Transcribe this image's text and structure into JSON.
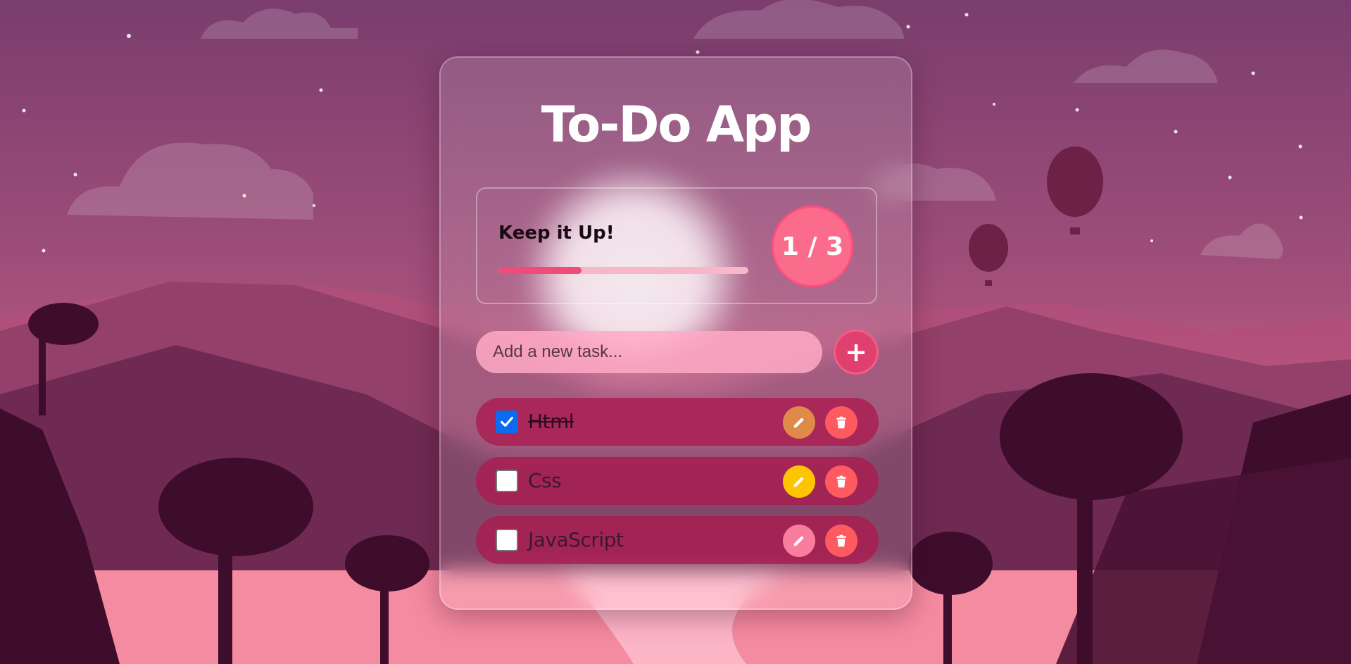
{
  "app": {
    "title": "To-Do App"
  },
  "stats": {
    "message": "Keep it Up!",
    "completed": 1,
    "total": 3,
    "counter_text": "1 / 3",
    "progress_fraction": 0.333
  },
  "new_task": {
    "placeholder": "Add a new task...",
    "value": "",
    "add_label": "+"
  },
  "tasks": [
    {
      "label": "Html",
      "completed": true,
      "edit_color": "#e08a4a"
    },
    {
      "label": "Css",
      "completed": false,
      "edit_color": "#ffc400"
    },
    {
      "label": "JavaScript",
      "completed": false,
      "edit_color": "#f97d9e"
    }
  ],
  "icons": {
    "edit": "pencil-icon",
    "delete": "trash-icon",
    "check": "checkmark-icon"
  },
  "colors": {
    "accent": "#f04c7a",
    "delete": "#ff5a5f",
    "checkbox_checked": "#0b6cf0"
  }
}
